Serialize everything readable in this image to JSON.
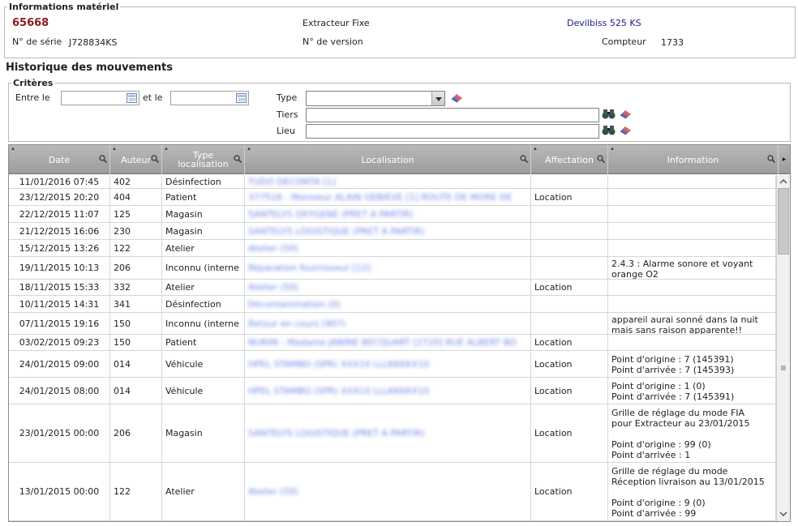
{
  "info": {
    "legend": "Informations matériel",
    "id": "65668",
    "type": "Extracteur Fixe",
    "brand": "Devilbiss 525 KS",
    "serial_label": "N° de série",
    "serial": "J728834KS",
    "version_label": "N° de version",
    "counter_label": "Compteur",
    "counter": "1733"
  },
  "history_title": "Historique des mouvements",
  "criteria": {
    "legend": "Critères",
    "between_label": "Entre le",
    "and_label": "et le",
    "type_label": "Type",
    "tiers_label": "Tiers",
    "lieu_label": "Lieu",
    "date_from": "",
    "date_to": "",
    "type_value": "",
    "tiers_value": "",
    "lieu_value": ""
  },
  "columns": [
    "Date",
    "Auteur",
    "Type localisation",
    "Localisation",
    "Affectation",
    "Information"
  ],
  "rows": [
    {
      "date": "11/01/2016 07:45",
      "auteur": "402",
      "type": "Désinfection",
      "loc": "TUDO DECONTA [1]",
      "aff": "",
      "info": ""
    },
    {
      "date": "23/12/2015 20:20",
      "auteur": "404",
      "type": "Patient",
      "loc": "377516 - Monsieur ALAIN GEBIEVE [1] ROUTE DE MORE DE",
      "aff": "Location",
      "info": ""
    },
    {
      "date": "22/12/2015 11:07",
      "auteur": "125",
      "type": "Magasin",
      "loc": "SANTELYS OXYGENE (PRET A PARTIR)",
      "aff": "",
      "info": ""
    },
    {
      "date": "21/12/2015 16:06",
      "auteur": "230",
      "type": "Magasin",
      "loc": "SANTELYS LOGISTIQUE (PRET A PARTIR)",
      "aff": "",
      "info": ""
    },
    {
      "date": "15/12/2015 13:26",
      "auteur": "122",
      "type": "Atelier",
      "loc": "Atelier (50)",
      "aff": "",
      "info": ""
    },
    {
      "date": "19/11/2015 10:13",
      "auteur": "206",
      "type": "Inconnu (interne",
      "loc": "Réparation fournisseur [12]",
      "aff": "",
      "info": "2.4.3 : Alarme sonore et voyant\norange O2"
    },
    {
      "date": "18/11/2015 15:33",
      "auteur": "332",
      "type": "Atelier",
      "loc": "Atelier (50)",
      "aff": "Location",
      "info": ""
    },
    {
      "date": "10/11/2015 14:31",
      "auteur": "341",
      "type": "Désinfection",
      "loc": "Décontamination (0)",
      "aff": "",
      "info": ""
    },
    {
      "date": "07/11/2015 19:16",
      "auteur": "150",
      "type": "Inconnu (interne",
      "loc": "Retour en cours (907)",
      "aff": "",
      "info": "appareil aurai sonné dans la nuit\nmais sans raison apparente!!"
    },
    {
      "date": "03/02/2015 09:23",
      "auteur": "150",
      "type": "Patient",
      "loc": "NU606 - Madame JANINE BECQUART [2720] RUE ALBERT BO",
      "aff": "Location",
      "info": ""
    },
    {
      "date": "24/01/2015 09:00",
      "auteur": "014",
      "type": "Véhicule",
      "loc": "HPEL STAMBO (SPR) XXX10 LLLKKKKX10",
      "aff": "Location",
      "info": "Point d'origine : 7 (145391)\nPoint d'arrivée : 7 (145393)"
    },
    {
      "date": "24/01/2015 08:00",
      "auteur": "014",
      "type": "Véhicule",
      "loc": "HPEL STAMBO (SPR) XXX10 LLLKKKKX10",
      "aff": "Location",
      "info": "Point d'origine : 1 (0)\nPoint d'arrivée : 7 (145391)"
    },
    {
      "date": "23/01/2015 00:00",
      "auteur": "206",
      "type": "Magasin",
      "loc": "SANTELYS LOGISTIQUE (PRET A PARTIR)",
      "aff": "Location",
      "info": "Grille de réglage du mode FIA\npour Extracteur au 23/01/2015\n\nPoint d'origine : 99 (0)\nPoint d'arrivée : 1"
    },
    {
      "date": "13/01/2015 00:00",
      "auteur": "122",
      "type": "Atelier",
      "loc": "Atelier (50)",
      "aff": "Location",
      "info": "Grille de réglage du mode\nRéception livraison au 13/01/2015\n\nPoint d'origine : 9 (0)\nPoint d'arrivée : 99"
    }
  ]
}
